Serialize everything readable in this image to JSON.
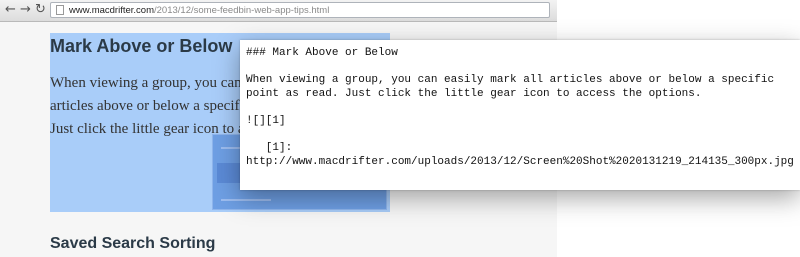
{
  "browser": {
    "back_icon": "back-arrow",
    "forward_icon": "forward-arrow",
    "reload_icon": "reload",
    "url_domain": "www.macdrifter.com",
    "url_path": "/2013/12/some-feedbin-web-app-tips.html"
  },
  "page": {
    "heading": "Mark Above or Below",
    "paragraph": "When viewing a group, you can easily mark all articles above or below a specific point as read. Just click the little gear icon to access the options.",
    "next_heading": "Saved Search Sorting"
  },
  "editor": {
    "text": "### Mark Above or Below\n\nWhen viewing a group, you can easily mark all articles above or below a specific\npoint as read. Just click the little gear icon to access the options.\n\n![][1]\n\n   [1]:\nhttp://www.macdrifter.com/uploads/2013/12/Screen%20Shot%2020131219_214135_300px.jpg"
  },
  "colors": {
    "selection": "#a9cdf9",
    "heading": "#2b3a47"
  }
}
